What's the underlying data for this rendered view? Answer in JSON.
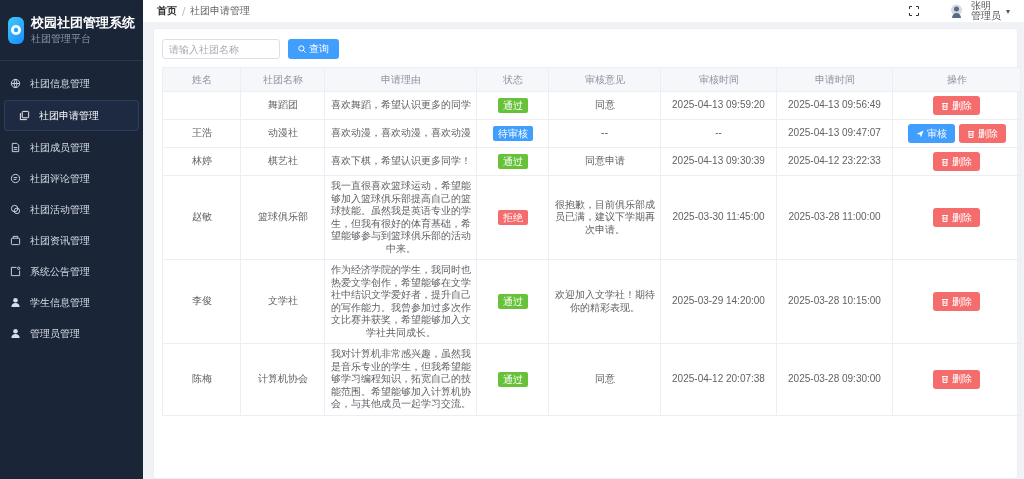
{
  "brand": {
    "title": "校园社团管理系统",
    "subtitle": "社团管理平台"
  },
  "sidebar": {
    "items": [
      {
        "label": "社团信息管理",
        "selected": false
      },
      {
        "label": "社团申请管理",
        "selected": true
      },
      {
        "label": "社团成员管理",
        "selected": false
      },
      {
        "label": "社团评论管理",
        "selected": false
      },
      {
        "label": "社团活动管理",
        "selected": false
      },
      {
        "label": "社团资讯管理",
        "selected": false
      },
      {
        "label": "系统公告管理",
        "selected": false
      },
      {
        "label": "学生信息管理",
        "selected": false
      },
      {
        "label": "管理员管理",
        "selected": false
      }
    ]
  },
  "header": {
    "breadcrumb": [
      "首页",
      "社团申请管理"
    ],
    "breadcrumb_separator": "/",
    "user": {
      "name": "张明",
      "role": "管理员",
      "caret": "▾"
    }
  },
  "search": {
    "placeholder": "请输入社团名称",
    "button": "查询"
  },
  "table": {
    "columns": [
      "姓名",
      "社团名称",
      "申请理由",
      "状态",
      "审核意见",
      "审核时间",
      "申请时间",
      "操作"
    ],
    "rows": [
      {
        "name": "",
        "club": "舞蹈团",
        "reason": "喜欢舞蹈，希望认识更多的同学",
        "status": {
          "label": "通过",
          "kind": "approved"
        },
        "opinion": "同意",
        "review_time": "2025-04-13 09:59:20",
        "apply_time": "2025-04-13 09:56:49",
        "actions": [
          {
            "label": "删除",
            "kind": "delete"
          }
        ]
      },
      {
        "name": "王浩",
        "club": "动漫社",
        "reason": "喜欢动漫，喜欢动漫，喜欢动漫",
        "status": {
          "label": "待审核",
          "kind": "pending"
        },
        "opinion": "--",
        "review_time": "--",
        "apply_time": "2025-04-13 09:47:07",
        "actions": [
          {
            "label": "审核",
            "kind": "review"
          },
          {
            "label": "删除",
            "kind": "delete"
          }
        ]
      },
      {
        "name": "林婷",
        "club": "棋艺社",
        "reason": "喜欢下棋，希望认识更多同学！",
        "status": {
          "label": "通过",
          "kind": "approved"
        },
        "opinion": "同意申请",
        "review_time": "2025-04-13 09:30:39",
        "apply_time": "2025-04-12 23:22:33",
        "actions": [
          {
            "label": "删除",
            "kind": "delete"
          }
        ]
      },
      {
        "name": "赵敏",
        "club": "篮球俱乐部",
        "reason": "我一直很喜欢篮球运动，希望能够加入篮球俱乐部提高自己的篮球技能。虽然我是英语专业的学生，但我有很好的体育基础，希望能够参与到篮球俱乐部的活动中来。",
        "status": {
          "label": "拒绝",
          "kind": "rejected"
        },
        "opinion": "很抱歉，目前俱乐部成员已满，建议下学期再次申请。",
        "review_time": "2025-03-30 11:45:00",
        "apply_time": "2025-03-28 11:00:00",
        "actions": [
          {
            "label": "删除",
            "kind": "delete"
          }
        ]
      },
      {
        "name": "李俊",
        "club": "文学社",
        "reason": "作为经济学院的学生，我同时也热爱文学创作，希望能够在文学社中结识文学爱好者，提升自己的写作能力。我曾参加过多次作文比赛并获奖，希望能够加入文学社共同成长。",
        "status": {
          "label": "通过",
          "kind": "approved"
        },
        "opinion": "欢迎加入文学社！期待你的精彩表现。",
        "review_time": "2025-03-29 14:20:00",
        "apply_time": "2025-03-28 10:15:00",
        "actions": [
          {
            "label": "删除",
            "kind": "delete"
          }
        ]
      },
      {
        "name": "陈梅",
        "club": "计算机协会",
        "reason": "我对计算机非常感兴趣，虽然我是音乐专业的学生，但我希望能够学习编程知识，拓宽自己的技能范围。希望能够加入计算机协会，与其他成员一起学习交流。",
        "status": {
          "label": "通过",
          "kind": "approved"
        },
        "opinion": "同意",
        "review_time": "2025-04-12 20:07:38",
        "apply_time": "2025-03-28 09:30:00",
        "actions": [
          {
            "label": "删除",
            "kind": "delete"
          }
        ]
      }
    ]
  }
}
